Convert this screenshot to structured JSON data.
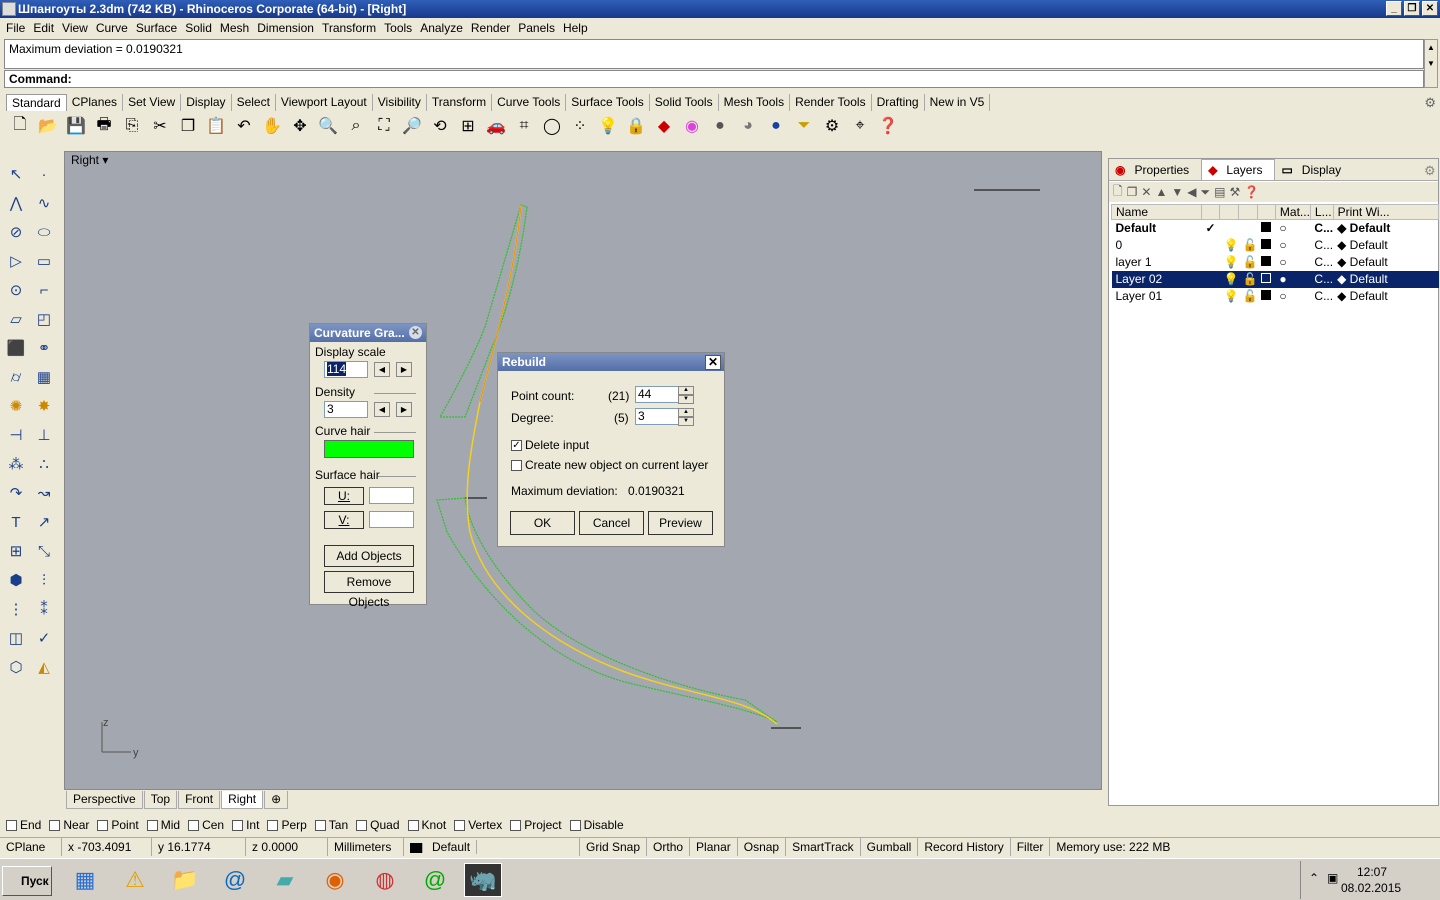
{
  "window": {
    "title": "Шпангоуты 2.3dm (742 KB) - Rhinoceros Corporate (64-bit) - [Right]"
  },
  "menu": [
    "File",
    "Edit",
    "View",
    "Curve",
    "Surface",
    "Solid",
    "Mesh",
    "Dimension",
    "Transform",
    "Tools",
    "Analyze",
    "Render",
    "Panels",
    "Help"
  ],
  "command": {
    "history": "Maximum deviation = 0.0190321",
    "prompt": "Command:"
  },
  "toolbar_tabs": [
    "Standard",
    "CPlanes",
    "Set View",
    "Display",
    "Select",
    "Viewport Layout",
    "Visibility",
    "Transform",
    "Curve Tools",
    "Surface Tools",
    "Solid Tools",
    "Mesh Tools",
    "Render Tools",
    "Drafting",
    "New in V5"
  ],
  "toolbar_icons": [
    "new-file-icon",
    "open-icon",
    "save-icon",
    "print-icon",
    "import-icon",
    "cut-icon",
    "copy-icon",
    "paste-icon",
    "undo-icon",
    "pan-icon",
    "move-view-icon",
    "zoom-icon",
    "zoom-window-icon",
    "zoom-extents-icon",
    "zoom-selected-icon",
    "rotate-view-icon",
    "four-viewports-icon",
    "car-icon",
    "grid-icon",
    "circle-icon",
    "points-icon",
    "light-icon",
    "lock-icon",
    "layer-icon",
    "color-wheel-icon",
    "shaded-icon",
    "rendered-icon",
    "sphere-icon",
    "filter-icon",
    "settings-icon",
    "snap-icon",
    "help-icon"
  ],
  "viewport": {
    "name": "Right",
    "axis_z": "z",
    "axis_y": "y"
  },
  "viewport_tabs": [
    "Perspective",
    "Top",
    "Front",
    "Right"
  ],
  "panel": {
    "tabs": [
      "Properties",
      "Layers",
      "Display"
    ],
    "columns": [
      "Name",
      "Mat...",
      "L...",
      "Print Wi..."
    ],
    "layers": [
      {
        "name": "Default",
        "current": "✓",
        "mat": "C...",
        "print": "Default"
      },
      {
        "name": "0",
        "current": "",
        "mat": "C...",
        "print": "Default"
      },
      {
        "name": "layer 1",
        "current": "",
        "mat": "C...",
        "print": "Default"
      },
      {
        "name": "Layer 02",
        "current": "",
        "mat": "C...",
        "print": "Default"
      },
      {
        "name": "Layer 01",
        "current": "",
        "mat": "C...",
        "print": "Default"
      }
    ]
  },
  "curvature": {
    "title": "Curvature Gra...",
    "display_scale_label": "Display scale",
    "display_scale": "114",
    "density_label": "Density",
    "density": "3",
    "curve_hair_label": "Curve hair",
    "curve_hair_color": "#00ff00",
    "surface_hair_label": "Surface hair",
    "u": "U:",
    "v": "V:",
    "add": "Add Objects",
    "remove": "Remove Objects"
  },
  "rebuild": {
    "title": "Rebuild",
    "point_count_label": "Point count:",
    "point_count_orig": "(21)",
    "point_count": "44",
    "degree_label": "Degree:",
    "degree_orig": "(5)",
    "degree": "3",
    "delete_input": "Delete input",
    "new_layer": "Create new object on current layer",
    "max_dev_label": "Maximum deviation:",
    "max_dev": "0.0190321",
    "ok": "OK",
    "cancel": "Cancel",
    "preview": "Preview"
  },
  "snaps": [
    "End",
    "Near",
    "Point",
    "Mid",
    "Cen",
    "Int",
    "Perp",
    "Tan",
    "Quad",
    "Knot",
    "Vertex",
    "Project",
    "Disable"
  ],
  "status": {
    "cplane": "CPlane",
    "x": "x -703.4091",
    "y": "y 16.1774",
    "z": "z 0.0000",
    "units": "Millimeters",
    "layer": "Default",
    "grid": "Grid Snap",
    "ortho": "Ortho",
    "planar": "Planar",
    "osnap": "Osnap",
    "smart": "SmartTrack",
    "gumball": "Gumball",
    "record": "Record History",
    "filter": "Filter",
    "memory": "Memory use: 222 MB"
  },
  "taskbar": {
    "start": "Пуск",
    "time": "12:07",
    "date": "08.02.2015"
  }
}
